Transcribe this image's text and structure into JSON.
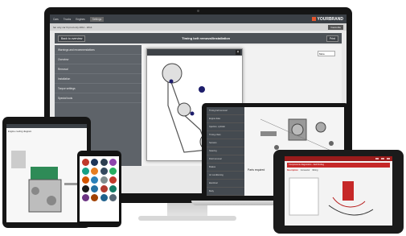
{
  "monitor": {
    "nav_tabs": [
      "Cars",
      "Trucks",
      "Engines",
      "Settings"
    ],
    "brand": "YOURBRAND",
    "subtitle": "fan only car fit prod only 2011 - 2014",
    "pill_label": "Favourite",
    "header": {
      "back_label": "Back to overview",
      "title": "Timing belt removal/installation",
      "print_label": "Print"
    },
    "sidebar": [
      "Warnings and recommendations",
      "Overview",
      "Removal",
      "Installation",
      "Torque settings",
      "Special tools"
    ],
    "main": {
      "prefix": "Rep",
      "dropdown": "More"
    }
  },
  "laptop": {
    "sidebar": [
      "Timing belt removal",
      "Engine data",
      "Injection, cylinder",
      "Timing chain",
      "Sensors",
      "Steering",
      "Fluid removal",
      "Brakes",
      "Air conditioning",
      "Electrical",
      "Body"
    ],
    "part_label": "Parts required"
  },
  "tablet_left": {
    "title": "Engine cooling diagram"
  },
  "tablet_right": {
    "title": "Components diagnostics - fault finding",
    "tabs": [
      "Description",
      "Connector",
      "Wiring"
    ]
  },
  "colors": {
    "accent": "#e4572e",
    "sidebar": "#5e6369",
    "topbar": "#3b4046",
    "tablet_red": "#c62828"
  },
  "phone": {
    "logo_colors": [
      "#c0392b",
      "#1d3557",
      "#2c3e50",
      "#8e44ad",
      "#16a085",
      "#e67e22",
      "#34495e",
      "#27ae60",
      "#d35400",
      "#2980b9",
      "#7f8c8d",
      "#c0392b",
      "#1a1a1a",
      "#2471a3",
      "#b03a2e",
      "#117a65",
      "#6c3483",
      "#a04000",
      "#1f618d",
      "#566573"
    ]
  }
}
